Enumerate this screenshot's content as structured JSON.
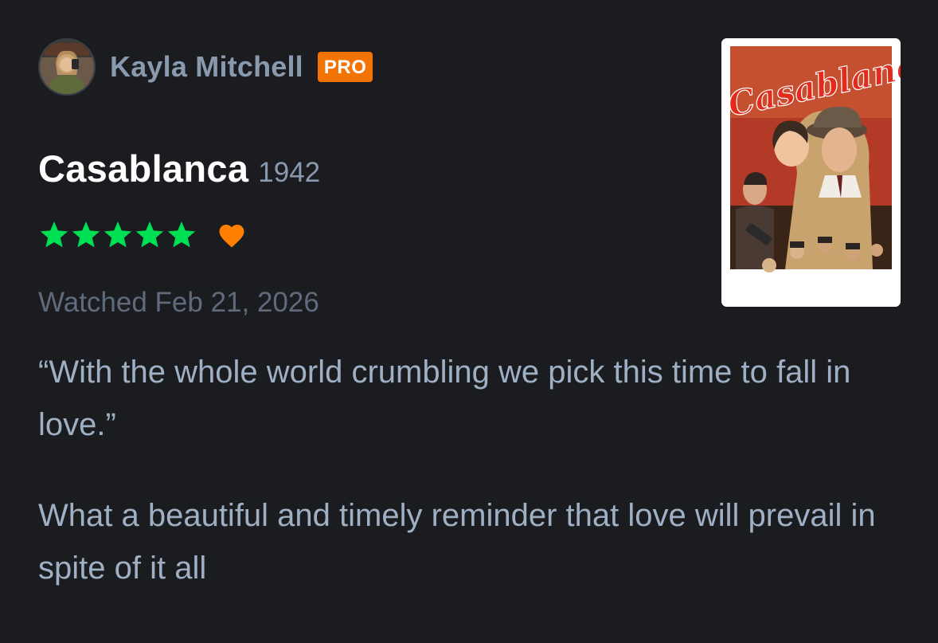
{
  "user": {
    "name": "Kayla Mitchell",
    "badge": "PRO"
  },
  "film": {
    "title": "Casablanca",
    "year": "1942",
    "poster_title_art": "Casablanca"
  },
  "rating": {
    "stars": 5,
    "liked": true
  },
  "watched": {
    "text": "Watched Feb 21, 2026"
  },
  "review": {
    "paragraphs": [
      "“With the whole world crumbling we pick this time to fall in love.”",
      "What a beautiful and timely reminder that love will prevail in spite of it all"
    ]
  },
  "colors": {
    "background": "#1a1c20",
    "star": "#00e054",
    "heart": "#ff8000",
    "pro_badge": "#f27405",
    "username": "#8a9aae",
    "review_text": "#9fb0c4"
  }
}
